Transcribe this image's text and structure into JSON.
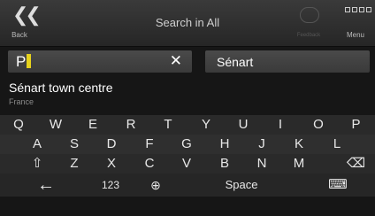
{
  "header": {
    "back_label": "Back",
    "title": "Search in All",
    "feedback_label": "Feedback",
    "menu_label": "Menu"
  },
  "search": {
    "query": "P",
    "city": "Sénart"
  },
  "results": [
    {
      "name": "Sénart town centre",
      "country": "France"
    }
  ],
  "keyboard": {
    "row1": [
      "Q",
      "W",
      "E",
      "R",
      "T",
      "Y",
      "U",
      "I",
      "O",
      "P"
    ],
    "row2": [
      "A",
      "S",
      "D",
      "F",
      "G",
      "H",
      "J",
      "K",
      "L"
    ],
    "row3": [
      "Z",
      "X",
      "C",
      "V",
      "B",
      "N",
      "M"
    ],
    "numbers_label": "123",
    "space_label": "Space"
  },
  "icons": {
    "back": "double-chevron-left-icon",
    "clear": "close-icon",
    "shift": "shift-icon",
    "backspace": "backspace-icon",
    "left_arrow": "arrow-left-icon",
    "globe": "globe-icon",
    "keyboard": "keyboard-icon",
    "menu": "menu-icon",
    "feedback": "speech-bubble-icon"
  },
  "colors": {
    "caret": "#e6d21c",
    "background": "#161616"
  }
}
